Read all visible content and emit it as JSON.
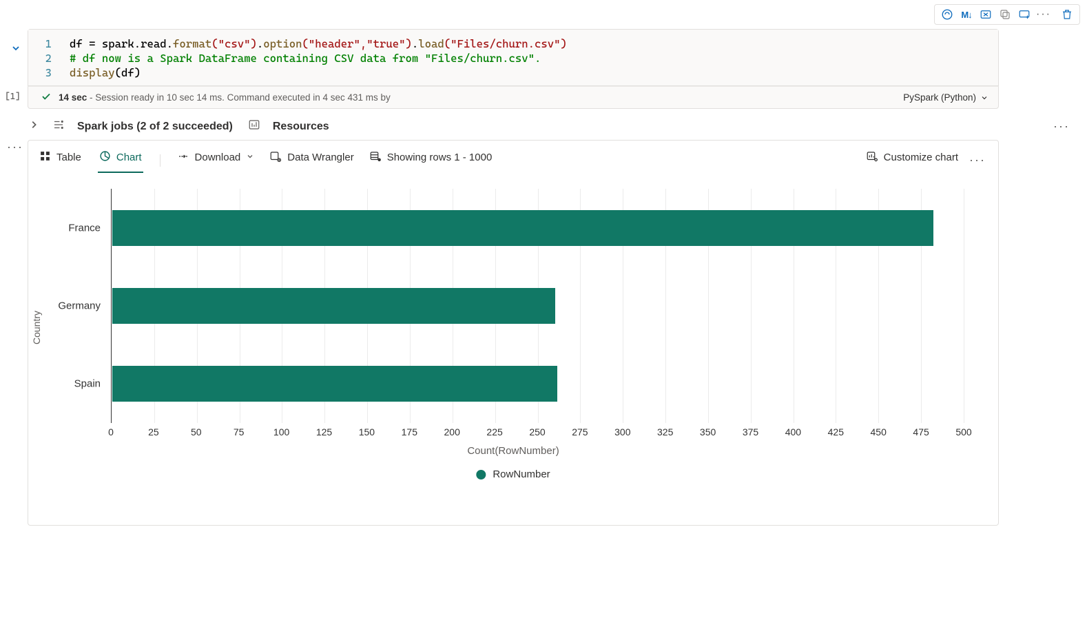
{
  "toolbar_icons": {
    "accel": "accelerate-icon",
    "markdown_label": "M↓",
    "clear_cell": "clear-cell-icon",
    "copy_cell": "copy-cell-icon",
    "add_below": "add-cell-below-icon",
    "more": "···",
    "delete": "delete-icon"
  },
  "cell": {
    "index_label": "[1]",
    "lines": {
      "n1": "1",
      "n2": "2",
      "n3": "3",
      "l1_pre": "df = spark.read.",
      "l1_fn1": "format",
      "l1_s1": "(\"csv\")",
      "l1_op1": ".",
      "l1_fn2": "option",
      "l1_s2": "(\"header\",\"true\")",
      "l1_op2": ".",
      "l1_fn3": "load",
      "l1_s3": "(\"Files/churn.csv\")",
      "l2": "# df now is a Spark DataFrame containing CSV data from \"Files/churn.csv\".",
      "l3_fn": "display",
      "l3_arg": "(df)"
    },
    "status_time": "14 sec",
    "status_rest": " - Session ready in 10 sec 14 ms. Command executed in 4 sec 431 ms by",
    "kernel_label": "PySpark (Python)"
  },
  "mid": {
    "spark_jobs": "Spark jobs (2 of 2 succeeded)",
    "resources": "Resources"
  },
  "out_toolbar": {
    "table": "Table",
    "chart": "Chart",
    "download": "Download",
    "data_wrangler": "Data Wrangler",
    "rows": "Showing rows 1 - 1000",
    "customize": "Customize chart"
  },
  "legend_label": "RowNumber",
  "x_title": "Count(RowNumber)",
  "y_title": "Country",
  "x_ticks": [
    "0",
    "25",
    "50",
    "75",
    "100",
    "125",
    "150",
    "175",
    "200",
    "225",
    "250",
    "275",
    "300",
    "325",
    "350",
    "375",
    "400",
    "425",
    "450",
    "475",
    "500"
  ],
  "chart_data": {
    "type": "bar",
    "orientation": "horizontal",
    "categories": [
      "France",
      "Germany",
      "Spain"
    ],
    "values": [
      482,
      260,
      261
    ],
    "xlabel": "Count(RowNumber)",
    "ylabel": "Country",
    "xlim": [
      0,
      500
    ],
    "series_name": "RowNumber",
    "bar_color": "#117865"
  }
}
